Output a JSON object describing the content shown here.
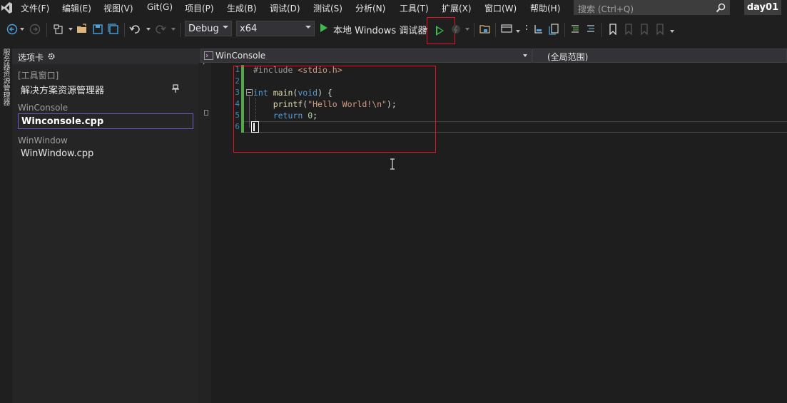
{
  "menu": {
    "items": [
      "文件(F)",
      "编辑(E)",
      "视图(V)",
      "Git(G)",
      "项目(P)",
      "生成(B)",
      "调试(D)",
      "测试(S)",
      "分析(N)",
      "工具(T)",
      "扩展(X)",
      "窗口(W)",
      "帮助(H)"
    ]
  },
  "search": {
    "placeholder": "搜索 (Ctrl+Q)"
  },
  "solution": {
    "name": "day01"
  },
  "toolbar": {
    "configuration": "Debug",
    "platform": "x64",
    "run_label": "本地 Windows 调试器"
  },
  "side_strip": {
    "label": "服务器资源管理器"
  },
  "tab_panel": {
    "title": "选项卡",
    "groups": [
      {
        "name": "[工具窗口]",
        "entries": [
          "解决方案资源管理器"
        ]
      },
      {
        "name": "WinConsole",
        "entries": [
          "Winconsole.cpp"
        ]
      },
      {
        "name": "WinWindow",
        "entries": [
          "WinWindow.cpp"
        ]
      }
    ]
  },
  "editor": {
    "nav_file": "WinConsole",
    "nav_scope": "(全局范围)",
    "line_numbers": [
      "1",
      "2",
      "3",
      "4",
      "5",
      "6"
    ],
    "code": {
      "line1_directive": "#include",
      "line1_header": "<stdio.h>",
      "line3_type": "int",
      "line3_func": "main",
      "line3_rest_open": "(",
      "line3_param": "void",
      "line3_rest_close": ") {",
      "line4_func": "printf",
      "line4_open": "(",
      "line4_string": "\"Hello World!\\n\"",
      "line4_close": ");",
      "line5_kw": "return",
      "line5_num": "0",
      "line5_end": ";"
    }
  },
  "colors": {
    "accent_highlight": "#e81123",
    "run_green": "#3cbc4b",
    "keyword": "#569cd6",
    "string": "#d69d85",
    "line_number": "#2b91af"
  }
}
